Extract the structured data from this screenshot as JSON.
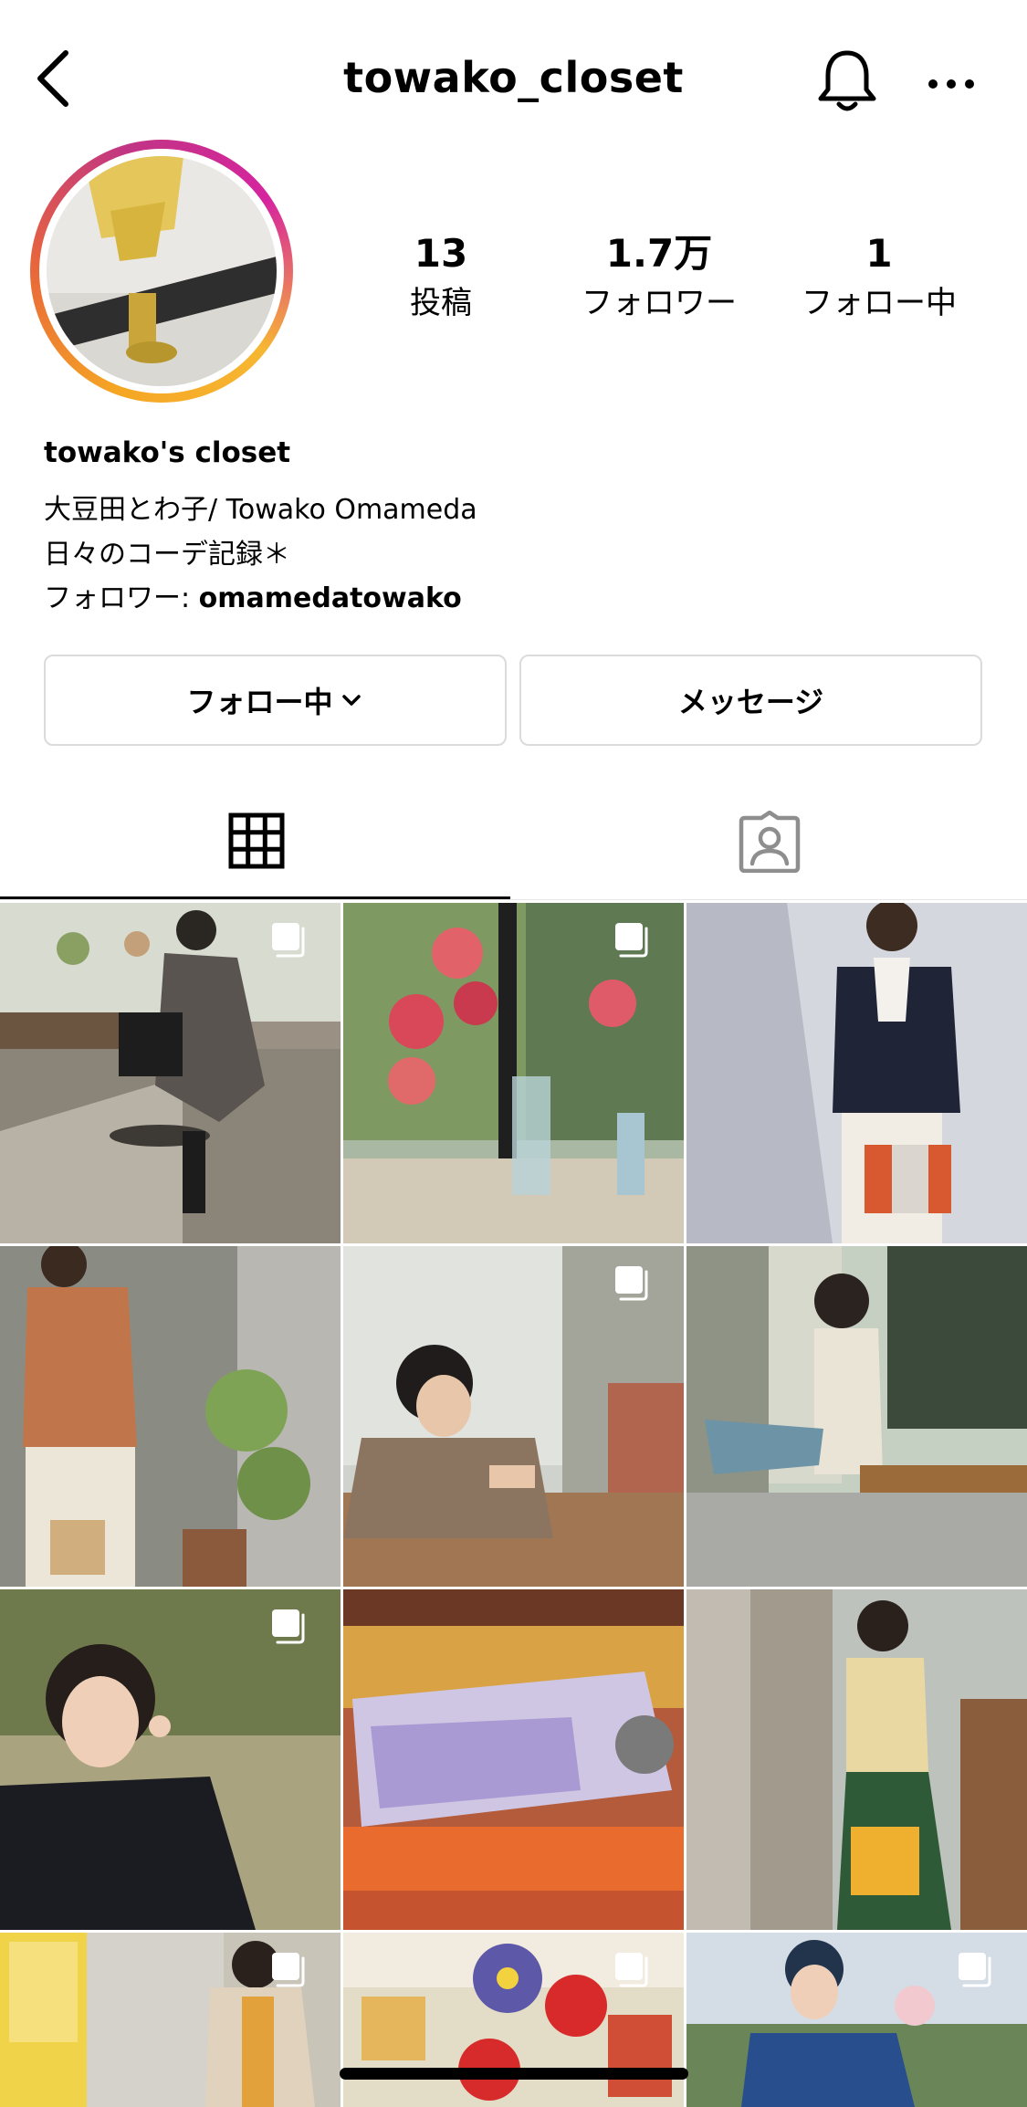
{
  "header": {
    "username": "towako_closet",
    "back_icon": "chevron-left-icon",
    "bell_icon": "bell-icon",
    "more_icon": "more-horizontal-icon"
  },
  "stats": [
    {
      "value": "13",
      "label": "投稿"
    },
    {
      "value": "1.7万",
      "label": "フォロワー"
    },
    {
      "value": "1",
      "label": "フォロー中"
    }
  ],
  "bio": {
    "name": "towako's closet",
    "line1": "大豆田とわ子/ Towako Omameda",
    "line2": "日々のコーデ記録＊",
    "followed_by_prefix": "フォロワー: ",
    "followed_by_user": "omamedatowako"
  },
  "buttons": {
    "following": "フォロー中",
    "message": "メッセージ"
  },
  "tabs": {
    "posts_icon": "grid-icon",
    "tagged_icon": "tagged-person-icon"
  },
  "grid_posts": [
    {
      "multi": true
    },
    {
      "multi": true
    },
    {
      "multi": false
    },
    {
      "multi": false
    },
    {
      "multi": true
    },
    {
      "multi": false
    },
    {
      "multi": true
    },
    {
      "multi": false
    },
    {
      "multi": false
    },
    {
      "multi": true
    },
    {
      "multi": true
    },
    {
      "multi": true
    }
  ],
  "colors": {
    "divider": "#dbdbdb",
    "accent_ring_start": "#f5a623",
    "accent_ring_end": "#c13584"
  }
}
